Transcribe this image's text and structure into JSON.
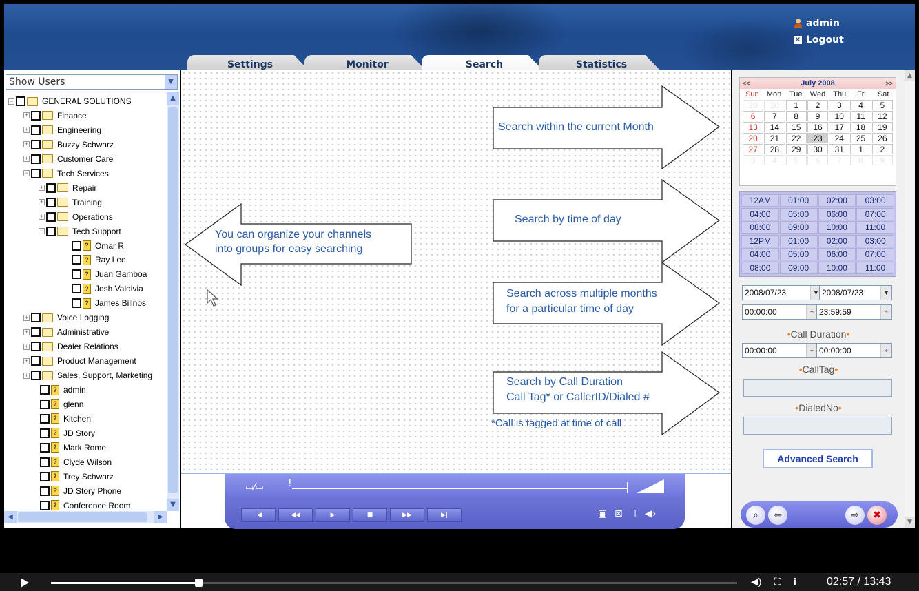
{
  "header": {
    "username": "admin",
    "logout_label": "Logout",
    "tabs": [
      "Settings",
      "Monitor",
      "Search",
      "Statistics"
    ],
    "active_tab": "Search"
  },
  "left_panel": {
    "show_users_value": "Show Users",
    "tree": [
      {
        "label": "GENERAL SOLUTIONS",
        "type": "folder",
        "expander": "−"
      },
      {
        "label": "Finance",
        "type": "folder",
        "expander": "+"
      },
      {
        "label": "Engineering",
        "type": "folder",
        "expander": "+"
      },
      {
        "label": "Buzzy Schwarz",
        "type": "folder",
        "expander": "+"
      },
      {
        "label": "Customer Care",
        "type": "folder",
        "expander": "+"
      },
      {
        "label": "Tech Services",
        "type": "folder",
        "expander": "−"
      },
      {
        "label": "Repair",
        "type": "folder",
        "expander": "+"
      },
      {
        "label": "Training",
        "type": "folder",
        "expander": "+"
      },
      {
        "label": "Operations",
        "type": "folder",
        "expander": "+"
      },
      {
        "label": "Tech Support",
        "type": "folder",
        "expander": "−"
      },
      {
        "label": "Omar R",
        "type": "user"
      },
      {
        "label": "Ray Lee",
        "type": "user"
      },
      {
        "label": "Juan Gamboa",
        "type": "user"
      },
      {
        "label": "Josh Valdivia",
        "type": "user"
      },
      {
        "label": "James Billnos",
        "type": "user"
      },
      {
        "label": "Voice Logging",
        "type": "folder",
        "expander": "+"
      },
      {
        "label": "Administrative",
        "type": "folder",
        "expander": "+"
      },
      {
        "label": "Dealer Relations",
        "type": "folder",
        "expander": "+"
      },
      {
        "label": "Product Management",
        "type": "folder",
        "expander": "+"
      },
      {
        "label": "Sales, Support, Marketing",
        "type": "folder",
        "expander": "+"
      },
      {
        "label": "admin",
        "type": "user"
      },
      {
        "label": "glenn",
        "type": "user"
      },
      {
        "label": "Kitchen",
        "type": "user"
      },
      {
        "label": "JD Story",
        "type": "user"
      },
      {
        "label": "Mark Rome",
        "type": "user"
      },
      {
        "label": "Clyde Wilson",
        "type": "user"
      },
      {
        "label": "Trey Schwarz",
        "type": "user"
      },
      {
        "label": "JD Story Phone",
        "type": "user"
      },
      {
        "label": "Conference Room",
        "type": "user"
      }
    ]
  },
  "callouts": {
    "groups": [
      "You can organize your channels",
      "into groups for easy searching"
    ],
    "month": "Search within the current Month",
    "time_of_day": "Search by time of day",
    "multi_month": [
      "Search across multiple months",
      "for a particular time of day"
    ],
    "duration": [
      "Search by Call Duration",
      "Call Tag* or CallerID/Dialed #"
    ],
    "footnote": "*Call is tagged at time of call"
  },
  "calendar": {
    "month_label": "July 2008",
    "prev_label": "<<",
    "next_label": ">>",
    "dow": [
      "Sun",
      "Mon",
      "Tue",
      "Wed",
      "Thu",
      "Fri",
      "Sat"
    ],
    "days": [
      "29",
      "30",
      "1",
      "2",
      "3",
      "4",
      "5",
      "6",
      "7",
      "8",
      "9",
      "10",
      "11",
      "12",
      "13",
      "14",
      "15",
      "16",
      "17",
      "18",
      "19",
      "20",
      "21",
      "22",
      "23",
      "24",
      "25",
      "26",
      "27",
      "28",
      "29",
      "30",
      "31",
      "1",
      "2",
      "3",
      "4",
      "5",
      "6",
      "7",
      "8",
      "9"
    ],
    "selected_day": "23"
  },
  "time_grid": [
    "12AM",
    "01:00",
    "02:00",
    "03:00",
    "04:00",
    "05:00",
    "06:00",
    "07:00",
    "08:00",
    "09:00",
    "10:00",
    "11:00",
    "12PM",
    "01:00",
    "02:00",
    "03:00",
    "04:00",
    "05:00",
    "06:00",
    "07:00",
    "08:00",
    "09:00",
    "10:00",
    "11:00"
  ],
  "search_form": {
    "start_date": "2008/07/23",
    "end_date": "2008/07/23",
    "start_time": "00:00:00",
    "end_time": "23:59:59",
    "call_duration_label": "Call Duration",
    "duration_min": "00:00:00",
    "duration_max": "00:00:00",
    "calltag_label": "CallTag",
    "calltag_value": "",
    "dialedno_label": "DialedNo",
    "dialedno_value": "",
    "advanced_search_label": "Advanced Search"
  },
  "video": {
    "time_display": "02:57 / 13:43",
    "progress": 0.215
  }
}
